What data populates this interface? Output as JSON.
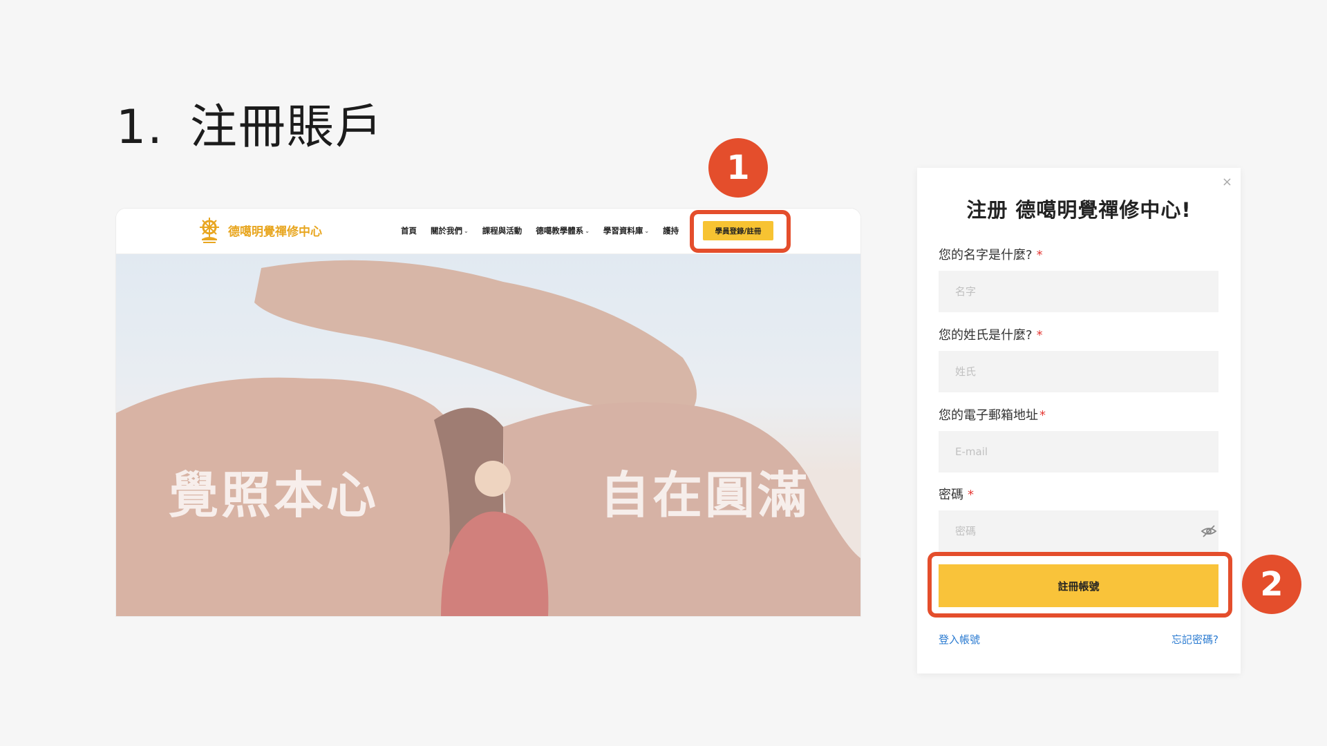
{
  "slide": {
    "number": "1.",
    "title": "注冊賬戶"
  },
  "site": {
    "logo_text": "德噶明覺禪修中心",
    "nav": [
      {
        "label": "首頁",
        "caret": false
      },
      {
        "label": "關於我們",
        "caret": true
      },
      {
        "label": "課程與活動",
        "caret": false
      },
      {
        "label": "德噶教學體系",
        "caret": true
      },
      {
        "label": "學習資料庫",
        "caret": true
      },
      {
        "label": "護持",
        "caret": false
      }
    ],
    "cta_label": "學員登錄/註冊",
    "hero_left": "覺照本心",
    "hero_right": "自在圓滿"
  },
  "modal": {
    "close": "×",
    "title": "注册 德噶明覺禪修中心!",
    "fields": [
      {
        "label": "您的名字是什麼?",
        "required": "*",
        "placeholder": "名字"
      },
      {
        "label": "您的姓氏是什麼?",
        "required": "*",
        "placeholder": "姓氏"
      },
      {
        "label": "您的電子郵箱地址",
        "required": "*",
        "placeholder": "E-mail"
      },
      {
        "label": "密碼",
        "required": "*",
        "placeholder": "密碼"
      }
    ],
    "submit_label": "註冊帳號",
    "login_link": "登入帳號",
    "forgot_link": "忘記密碼?"
  },
  "callouts": {
    "one": "1",
    "two": "2"
  },
  "colors": {
    "accent": "#e44e2c",
    "button": "#f9c33a",
    "link": "#2b7bd1",
    "logo": "#e8a620"
  },
  "icons": {
    "logo": "dharma-wheel-icon",
    "password_toggle": "eye-slash-icon"
  }
}
